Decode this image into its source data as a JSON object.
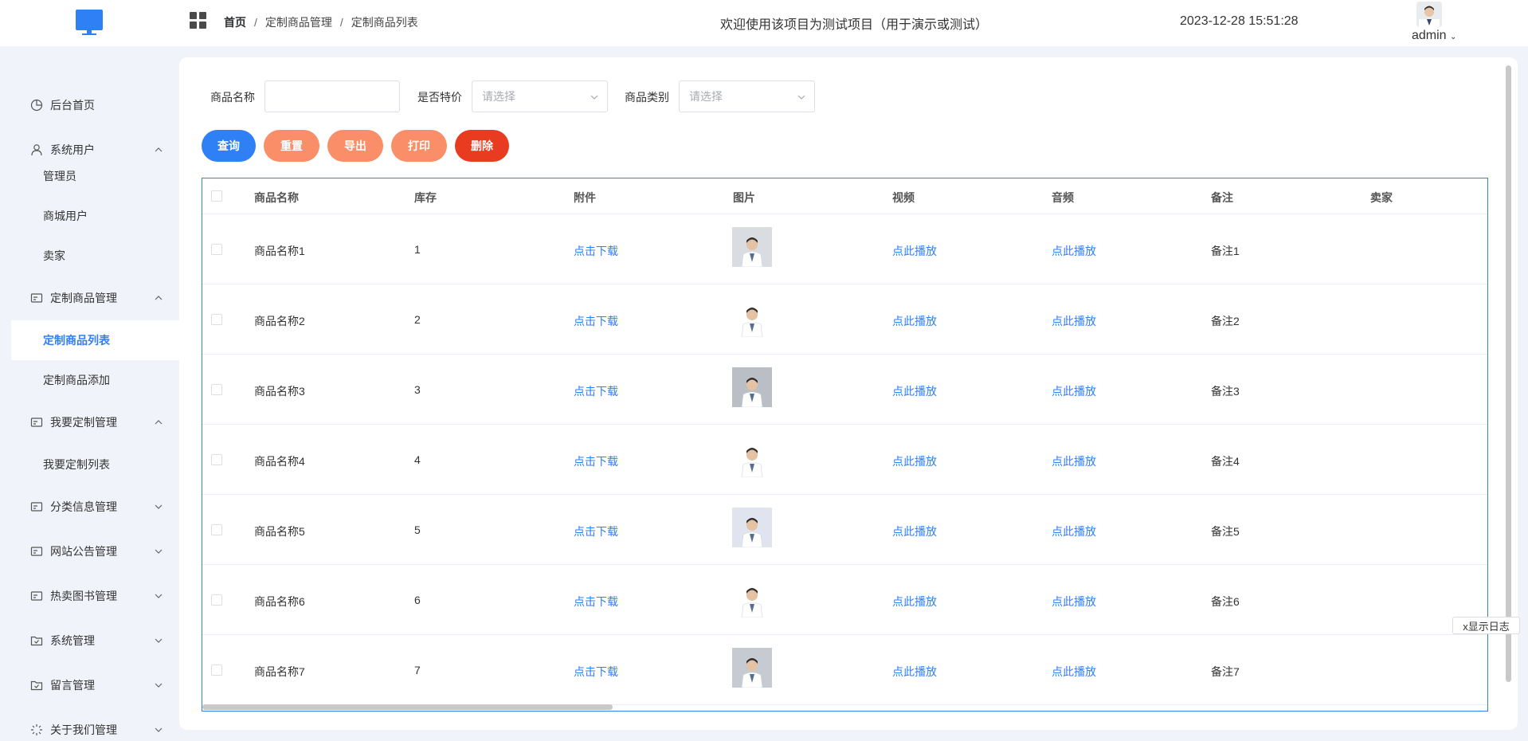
{
  "header": {
    "breadcrumb": [
      "首页",
      "定制商品管理",
      "定制商品列表"
    ],
    "title": "欢迎使用该项目为测试项目（用于演示或测试）",
    "time": "2023-12-28 15:51:28",
    "user": "admin"
  },
  "sidebar": {
    "items": [
      {
        "label": "后台首页",
        "icon": "clock-icon"
      },
      {
        "label": "系统用户",
        "icon": "user-icon",
        "expanded": true
      },
      {
        "label": "管理员",
        "sub": true
      },
      {
        "label": "商城用户",
        "sub": true
      },
      {
        "label": "卖家",
        "sub": true
      },
      {
        "label": "定制商品管理",
        "icon": "card-icon",
        "expanded": true
      },
      {
        "label": "定制商品列表",
        "sub": true,
        "active": true
      },
      {
        "label": "定制商品添加",
        "sub": true
      },
      {
        "label": "我要定制管理",
        "icon": "card-icon",
        "expanded": true
      },
      {
        "label": "我要定制列表",
        "sub": true
      },
      {
        "label": "分类信息管理",
        "icon": "card-icon",
        "expanded": false
      },
      {
        "label": "网站公告管理",
        "icon": "card-icon",
        "expanded": false
      },
      {
        "label": "热卖图书管理",
        "icon": "card-icon",
        "expanded": false
      },
      {
        "label": "系统管理",
        "icon": "folder-check-icon",
        "expanded": false
      },
      {
        "label": "留言管理",
        "icon": "folder-check-icon",
        "expanded": false
      },
      {
        "label": "关于我们管理",
        "icon": "loading-icon",
        "expanded": false
      }
    ]
  },
  "filters": {
    "name_label": "商品名称",
    "name_value": "",
    "special_label": "是否特价",
    "special_placeholder": "请选择",
    "category_label": "商品类别",
    "category_placeholder": "请选择"
  },
  "buttons": {
    "query": "查询",
    "reset": "重置",
    "export": "导出",
    "print": "打印",
    "delete": "删除"
  },
  "colors": {
    "primary": "#2f7ff5",
    "orange": "#f98e68",
    "red": "#e93b1f"
  },
  "table": {
    "headers": [
      "商品名称",
      "库存",
      "附件",
      "图片",
      "视频",
      "音频",
      "备注",
      "卖家"
    ],
    "rows": [
      {
        "name": "商品名称1",
        "stock": "1",
        "attachment": "点击下载",
        "video": "点此播放",
        "audio": "点此播放",
        "remark": "备注1",
        "seller": ""
      },
      {
        "name": "商品名称2",
        "stock": "2",
        "attachment": "点击下载",
        "video": "点此播放",
        "audio": "点此播放",
        "remark": "备注2",
        "seller": ""
      },
      {
        "name": "商品名称3",
        "stock": "3",
        "attachment": "点击下载",
        "video": "点此播放",
        "audio": "点此播放",
        "remark": "备注3",
        "seller": ""
      },
      {
        "name": "商品名称4",
        "stock": "4",
        "attachment": "点击下载",
        "video": "点此播放",
        "audio": "点此播放",
        "remark": "备注4",
        "seller": ""
      },
      {
        "name": "商品名称5",
        "stock": "5",
        "attachment": "点击下载",
        "video": "点此播放",
        "audio": "点此播放",
        "remark": "备注5",
        "seller": ""
      },
      {
        "name": "商品名称6",
        "stock": "6",
        "attachment": "点击下载",
        "video": "点此播放",
        "audio": "点此播放",
        "remark": "备注6",
        "seller": ""
      },
      {
        "name": "商品名称7",
        "stock": "7",
        "attachment": "点击下载",
        "video": "点此播放",
        "audio": "点此播放",
        "remark": "备注7",
        "seller": ""
      }
    ]
  },
  "log_button": "x显示日志"
}
